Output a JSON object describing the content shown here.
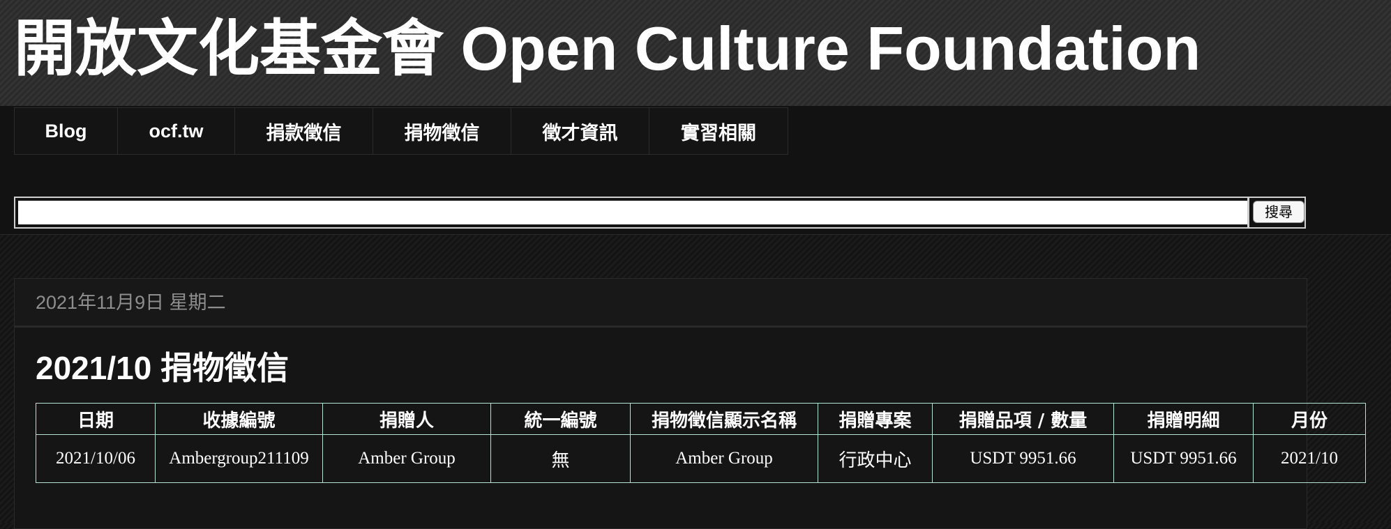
{
  "site": {
    "title": "開放文化基金會 Open Culture Foundation"
  },
  "nav": {
    "items": [
      {
        "label": "Blog"
      },
      {
        "label": "ocf.tw"
      },
      {
        "label": "捐款徵信"
      },
      {
        "label": "捐物徵信"
      },
      {
        "label": "徵才資訊"
      },
      {
        "label": "實習相關"
      }
    ]
  },
  "search": {
    "value": "",
    "button_label": "搜尋"
  },
  "post": {
    "date": "2021年11月9日 星期二",
    "title": "2021/10 捐物徵信",
    "table": {
      "headers": [
        "日期",
        "收據編號",
        "捐贈人",
        "統一編號",
        "捐物徵信顯示名稱",
        "捐贈專案",
        "捐贈品項 / 數量",
        "捐贈明細",
        "月份"
      ],
      "rows": [
        [
          "2021/10/06",
          "Ambergroup211109",
          "Amber Group",
          "無",
          "Amber Group",
          "行政中心",
          "USDT 9951.66",
          "USDT 9951.66",
          "2021/10"
        ]
      ]
    }
  },
  "colors": {
    "background": "#121212",
    "header_background": "#2d2d2d",
    "table_border": "#b6e3d2",
    "date_text": "#8e8e8e"
  }
}
